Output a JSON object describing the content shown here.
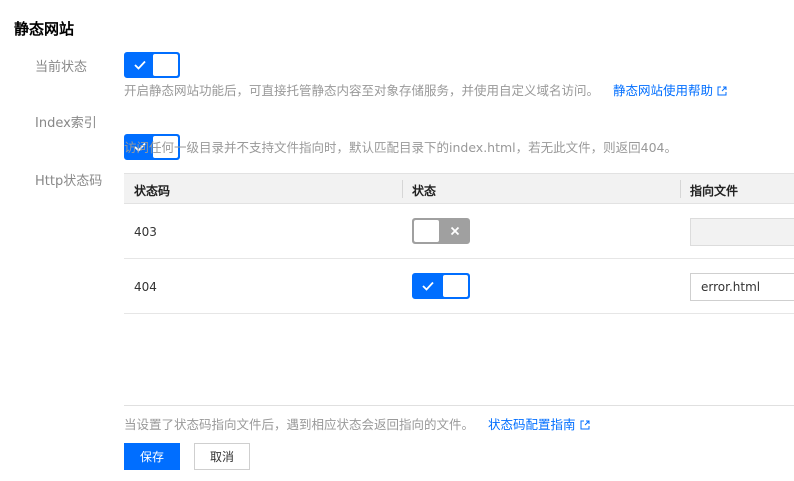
{
  "page": {
    "title": "静态网站"
  },
  "status": {
    "label": "当前状态",
    "enabled": true,
    "description": "开启静态网站功能后，可直接托管静态内容至对象存储服务，并使用自定义域名访问。",
    "help_link": "静态网站使用帮助"
  },
  "index": {
    "label": "Index索引",
    "enabled": true,
    "description": "访问任何一级目录并不支持文件指向时，默认匹配目录下的index.html，若无此文件，则返回404。"
  },
  "http": {
    "label": "Http状态码",
    "columns": [
      "状态码",
      "状态",
      "指向文件"
    ],
    "rows": [
      {
        "code": "403",
        "enabled": false,
        "file": ""
      },
      {
        "code": "404",
        "enabled": true,
        "file": "error.html"
      }
    ],
    "note": "当设置了状态码指向文件后，遇到相应状态会返回指向的文件。",
    "guide_link": "状态码配置指南"
  },
  "actions": {
    "save": "保存",
    "cancel": "取消"
  },
  "colors": {
    "accent": "#006eff",
    "toggle_off": "#a0a0a0"
  }
}
